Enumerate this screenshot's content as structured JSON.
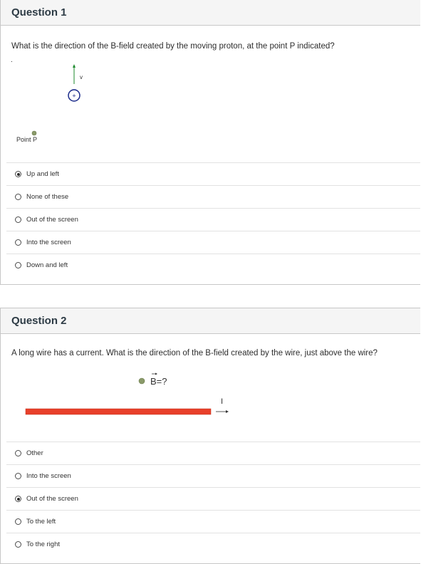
{
  "question1": {
    "title": "Question 1",
    "prompt": "What is the direction of the B-field created by the moving proton, at the point P indicated?",
    "figure": {
      "velocity_label": "v",
      "proton_symbol": "+",
      "point_label": "Point P",
      "stray_mark": "."
    },
    "answers": [
      {
        "label": "Up and left",
        "selected": true
      },
      {
        "label": "None of these",
        "selected": false
      },
      {
        "label": "Out of the screen",
        "selected": false
      },
      {
        "label": "Into the screen",
        "selected": false
      },
      {
        "label": "Down and left",
        "selected": false
      }
    ]
  },
  "question2": {
    "title": "Question 2",
    "prompt": "A long wire has a current.  What is the direction of the B-field created by the wire, just above the wire?",
    "figure": {
      "field_label": "B=?",
      "current_label": "I"
    },
    "answers": [
      {
        "label": "Other",
        "selected": false
      },
      {
        "label": "Into the screen",
        "selected": false
      },
      {
        "label": "Out of the screen",
        "selected": true
      },
      {
        "label": "To the left",
        "selected": false
      },
      {
        "label": "To the right",
        "selected": false
      }
    ]
  },
  "colors": {
    "wire": "#e8402a",
    "arrow_green": "#1e8a2e",
    "proton_outline": "#1a2a8a",
    "point": "#8a9a6a"
  }
}
